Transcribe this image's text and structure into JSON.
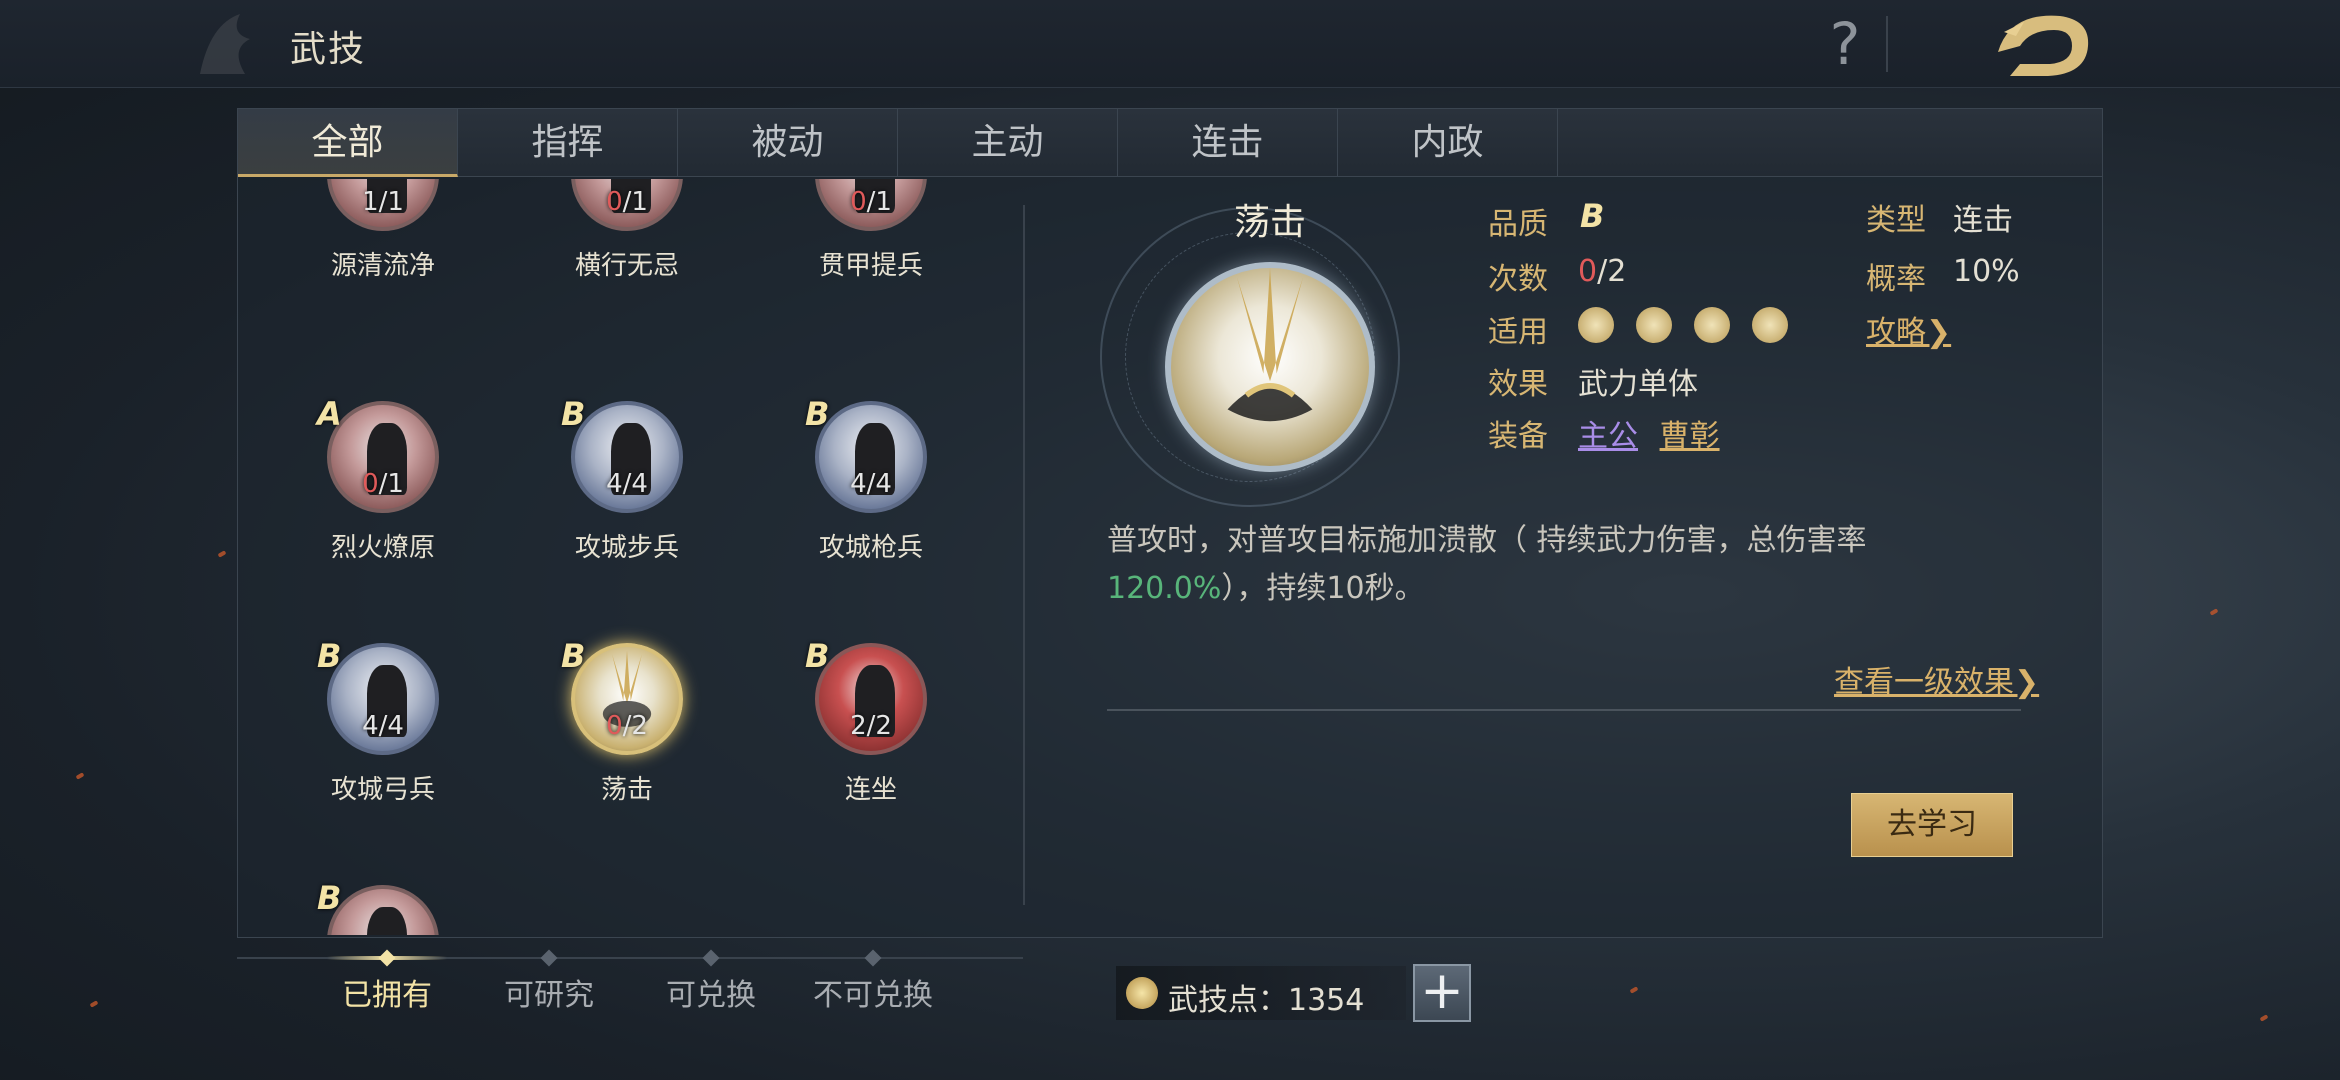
{
  "header": {
    "title": "武技",
    "help_label": "?"
  },
  "tabs": [
    {
      "label": "全部",
      "active": true
    },
    {
      "label": "指挥",
      "active": false
    },
    {
      "label": "被动",
      "active": false
    },
    {
      "label": "主动",
      "active": false
    },
    {
      "label": "连击",
      "active": false
    },
    {
      "label": "内政",
      "active": false
    }
  ],
  "skills": [
    {
      "name": "源清流净",
      "grade": "",
      "have": "1",
      "total": "/1",
      "style": "red"
    },
    {
      "name": "横行无忌",
      "grade": "",
      "have": "0",
      "total": "/1",
      "style": "red"
    },
    {
      "name": "贯甲提兵",
      "grade": "",
      "have": "0",
      "total": "/1",
      "style": "red"
    },
    {
      "name": "烈火燎原",
      "grade": "A",
      "have": "0",
      "total": "/1",
      "style": "red"
    },
    {
      "name": "攻城步兵",
      "grade": "B",
      "have": "4",
      "total": "/4",
      "style": "blue"
    },
    {
      "name": "攻城枪兵",
      "grade": "B",
      "have": "4",
      "total": "/4",
      "style": "blue"
    },
    {
      "name": "攻城弓兵",
      "grade": "B",
      "have": "4",
      "total": "/4",
      "style": "blue"
    },
    {
      "name": "荡击",
      "grade": "B",
      "have": "0",
      "total": "/2",
      "style": "gold"
    },
    {
      "name": "连坐",
      "grade": "B",
      "have": "2",
      "total": "/2",
      "style": "crimson"
    },
    {
      "name": "",
      "grade": "B",
      "have": "",
      "total": "",
      "style": "red"
    }
  ],
  "detail": {
    "name": "荡击",
    "quality_label": "品质",
    "quality_value": "B",
    "count_label": "次数",
    "count_have": "0",
    "count_total": "/2",
    "applies_label": "适用",
    "applies_icons": [
      "shield-unit-icon",
      "bow-unit-icon",
      "spear-unit-icon",
      "cavalry-unit-icon"
    ],
    "effect_label": "效果",
    "effect_value": "武力单体",
    "equip_label": "装备",
    "equip_1": "主公",
    "equip_2": "曹彰",
    "type_label": "类型",
    "type_value": "连击",
    "rate_label": "概率",
    "rate_value": "10%",
    "guide_link": "攻略❯",
    "desc_part1": "普攻时，对普攻目标施加溃散（ 持续武力伤害，总伤害率",
    "desc_rate": "120.0%",
    "desc_part2": "），持续10秒。",
    "view_level": "查看一级效果❯",
    "learn_button": "去学习"
  },
  "filters": [
    {
      "label": "已拥有",
      "active": true
    },
    {
      "label": "可研究",
      "active": false
    },
    {
      "label": "可兑换",
      "active": false
    },
    {
      "label": "不可兑换",
      "active": false
    }
  ],
  "points": {
    "label": "武技点：1354",
    "plus": "+"
  },
  "colors": {
    "accent_gold": "#d9b26a",
    "grade_yellow": "#f3e3a6",
    "count_red": "#e05a5a",
    "rate_green": "#58b57a",
    "equip_purple": "#a98de8"
  }
}
